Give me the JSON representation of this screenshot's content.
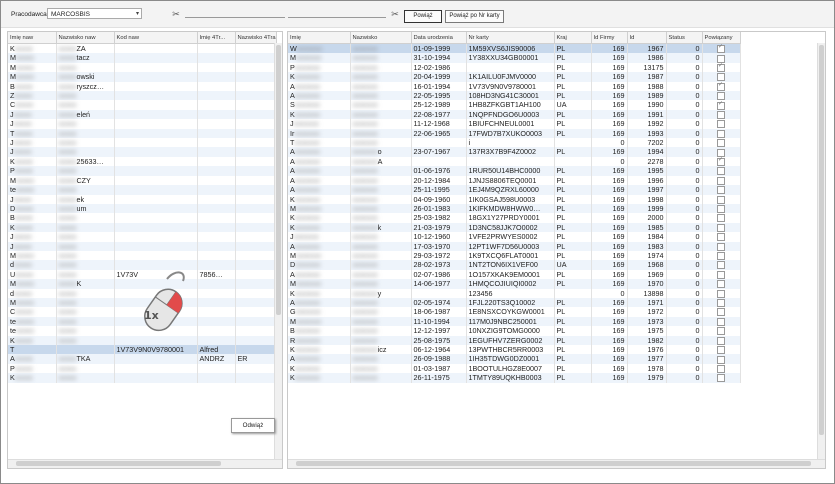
{
  "toolbar": {
    "employer_label": "Pracodawca",
    "employer_value": "MARCOSBIS",
    "link_button": "Powiąż",
    "link_by_card_button": "Powiąż po Nr karty"
  },
  "left_table": {
    "headers": [
      "Imię naw",
      "Nazwisko naw",
      "Kod naw",
      "Imię 4Tr...",
      "Nazwisko 4Trans"
    ],
    "rows": [
      [
        "K",
        "ZA",
        "",
        "",
        ""
      ],
      [
        "M",
        "tacz",
        "",
        "",
        ""
      ],
      [
        "M",
        "",
        "",
        "",
        ""
      ],
      [
        "M",
        "owski",
        "",
        "",
        ""
      ],
      [
        "B",
        "ryszcz…",
        "",
        "",
        ""
      ],
      [
        "Z",
        "",
        "",
        "",
        ""
      ],
      [
        "C",
        "",
        "",
        "",
        ""
      ],
      [
        "J",
        "eleń",
        "",
        "",
        ""
      ],
      [
        "J",
        "",
        "",
        "",
        ""
      ],
      [
        "T",
        "",
        "",
        "",
        ""
      ],
      [
        "J",
        "",
        "",
        "",
        ""
      ],
      [
        "J",
        "",
        "",
        "",
        ""
      ],
      [
        "K",
        "25633…",
        "",
        "",
        ""
      ],
      [
        "P",
        "",
        "",
        "",
        ""
      ],
      [
        "M",
        "CZY",
        "",
        "",
        ""
      ],
      [
        "te",
        "",
        "",
        "",
        ""
      ],
      [
        "J",
        "ek",
        "",
        "",
        ""
      ],
      [
        "D",
        "um",
        "",
        "",
        ""
      ],
      [
        "B",
        "",
        "",
        "",
        ""
      ],
      [
        "K",
        "",
        "",
        "",
        ""
      ],
      [
        "J",
        "",
        "",
        "",
        ""
      ],
      [
        "J",
        "",
        "",
        "",
        ""
      ],
      [
        "M",
        "",
        "",
        "",
        ""
      ],
      [
        "d",
        "",
        "",
        "",
        ""
      ],
      [
        "U",
        "",
        "1V73V",
        "7856…",
        ""
      ],
      [
        "M",
        "K",
        "",
        "",
        ""
      ],
      [
        "d",
        "",
        "",
        "",
        ""
      ],
      [
        "M",
        "",
        "",
        "",
        ""
      ],
      [
        "C",
        "",
        "",
        "",
        ""
      ],
      [
        "te",
        "",
        "",
        "",
        ""
      ],
      [
        "te",
        "",
        "",
        "",
        ""
      ],
      [
        "K",
        "",
        "",
        "",
        ""
      ],
      [
        "T",
        "",
        "1V73V9N0V9780001",
        "Alfred",
        ""
      ],
      [
        "A",
        "TKA",
        "",
        "ANDRZ",
        "ER"
      ],
      [
        "P",
        "",
        "",
        "",
        ""
      ],
      [
        "K",
        "",
        "",
        "",
        ""
      ]
    ],
    "selected_index": 32
  },
  "context_menu": {
    "item": "Odwiąż"
  },
  "click_badge": "1x",
  "right_table": {
    "headers": [
      "Imię",
      "Nazwisko",
      "Data urodzenia",
      "Nr karty",
      "Kraj",
      "Id Firmy",
      "Id",
      "Status",
      "Powiązany"
    ],
    "rows": [
      [
        "W",
        "",
        "01-09-1999",
        "1M59XVS6JIS90006",
        "PL",
        "169",
        "1967",
        "0",
        "on"
      ],
      [
        "M",
        "",
        "31-10-1994",
        "1Y38XXU34GB00001",
        "PL",
        "169",
        "1986",
        "0",
        "off"
      ],
      [
        "P",
        "",
        "12-02-1986",
        "",
        "PL",
        "169",
        "13175",
        "0",
        "on"
      ],
      [
        "K",
        "",
        "20-04-1999",
        "1K1AILU0FJMV0000",
        "PL",
        "169",
        "1987",
        "0",
        "off"
      ],
      [
        "A",
        "",
        "16-01-1994",
        "1V73V9N0V9780001",
        "PL",
        "169",
        "1988",
        "0",
        "on"
      ],
      [
        "A",
        "",
        "22-05-1995",
        "108HD3NG41C30001",
        "PL",
        "169",
        "1989",
        "0",
        "off"
      ],
      [
        "S",
        "",
        "25-12-1989",
        "1HB8ZFKGBT1AH100",
        "UA",
        "169",
        "1990",
        "0",
        "on"
      ],
      [
        "K",
        "",
        "22-08-1977",
        "1NQPFNDGO6U0003",
        "PL",
        "169",
        "1991",
        "0",
        "off"
      ],
      [
        "J",
        "",
        "11-12-1968",
        "1BIUFCHNEUL0001",
        "PL",
        "169",
        "1992",
        "0",
        "off"
      ],
      [
        "Ir",
        "",
        "22-06-1965",
        "17FWD7B7XUKO0003",
        "PL",
        "169",
        "1993",
        "0",
        "off"
      ],
      [
        "T",
        "",
        "",
        "i",
        "",
        "0",
        "7202",
        "0",
        "off"
      ],
      [
        "A",
        "o",
        "23-07-1967",
        "137R3X7B9F4Z0002",
        "PL",
        "169",
        "1994",
        "0",
        "off"
      ],
      [
        "A",
        "A",
        "",
        "",
        "",
        "0",
        "2278",
        "0",
        "on"
      ],
      [
        "A",
        "",
        "01-06-1976",
        "1RUR50U14BHC0000",
        "PL",
        "169",
        "1995",
        "0",
        "off"
      ],
      [
        "A",
        "",
        "20-12-1984",
        "1JNJS8806TEQ0001",
        "PL",
        "169",
        "1996",
        "0",
        "off"
      ],
      [
        "A",
        "",
        "25-11-1995",
        "1EJ4M9QZRXL60000",
        "PL",
        "169",
        "1997",
        "0",
        "off"
      ],
      [
        "K",
        "",
        "04-09-1960",
        "1IK0GSAJ598U0003",
        "PL",
        "169",
        "1998",
        "0",
        "off"
      ],
      [
        "M",
        "",
        "26-01-1983",
        "1KIFKMDW8HWW0…",
        "PL",
        "169",
        "1999",
        "0",
        "off"
      ],
      [
        "K",
        "",
        "25-03-1982",
        "18GX1Y27PRDY0001",
        "PL",
        "169",
        "2000",
        "0",
        "off"
      ],
      [
        "K",
        "k",
        "21-03-1979",
        "1D3NC58JJK7O0002",
        "PL",
        "169",
        "1985",
        "0",
        "off"
      ],
      [
        "J",
        "",
        "10-12-1960",
        "1VFE2PRWYES0002",
        "PL",
        "169",
        "1984",
        "0",
        "off"
      ],
      [
        "A",
        "",
        "17-03-1970",
        "12PT1WF7D56U0003",
        "PL",
        "169",
        "1983",
        "0",
        "off"
      ],
      [
        "M",
        "",
        "29-03-1972",
        "1K9TXCQ6FLAT0001",
        "PL",
        "169",
        "1974",
        "0",
        "off"
      ],
      [
        "D",
        "",
        "28-02-1973",
        "1NT2TON6IX1VEF00",
        "UA",
        "169",
        "1968",
        "0",
        "off"
      ],
      [
        "A",
        "",
        "02-07-1986",
        "1O157XKAK9EM0001",
        "PL",
        "169",
        "1969",
        "0",
        "off"
      ],
      [
        "M",
        "",
        "14-06-1977",
        "1HMQCOJIUIQI0002",
        "PL",
        "169",
        "1970",
        "0",
        "off"
      ],
      [
        "K",
        "y",
        "",
        "123456",
        "",
        "0",
        "13898",
        "0",
        "off"
      ],
      [
        "A",
        "",
        "02-05-1974",
        "1FJL220TS3Q10002",
        "PL",
        "169",
        "1971",
        "0",
        "off"
      ],
      [
        "G",
        "",
        "18-06-1987",
        "1E8NSXCOYKGW0001",
        "PL",
        "169",
        "1972",
        "0",
        "off"
      ],
      [
        "M",
        "",
        "11-10-1994",
        "117M0J9NBC250001",
        "PL",
        "169",
        "1973",
        "0",
        "off"
      ],
      [
        "B",
        "",
        "12-12-1997",
        "10NXZIG9TOMG0000",
        "PL",
        "169",
        "1975",
        "0",
        "off"
      ],
      [
        "R",
        "",
        "25-08-1975",
        "1EGUFHV7ZERG0002",
        "PL",
        "169",
        "1982",
        "0",
        "off"
      ],
      [
        "K",
        "icz",
        "06-12-1964",
        "13PWTHBCR5RR0003",
        "PL",
        "169",
        "1976",
        "0",
        "off"
      ],
      [
        "A",
        "",
        "26-09-1988",
        "1IH35TDWG0DZ0001",
        "PL",
        "169",
        "1977",
        "0",
        "off"
      ],
      [
        "K",
        "",
        "01-03-1987",
        "1BOOTULHGZ8E0007",
        "PL",
        "169",
        "1978",
        "0",
        "off"
      ],
      [
        "K",
        "",
        "26-11-1975",
        "1TMTY89UQKHB0003",
        "PL",
        "169",
        "1979",
        "0",
        "off"
      ]
    ],
    "selected_index": 0
  }
}
